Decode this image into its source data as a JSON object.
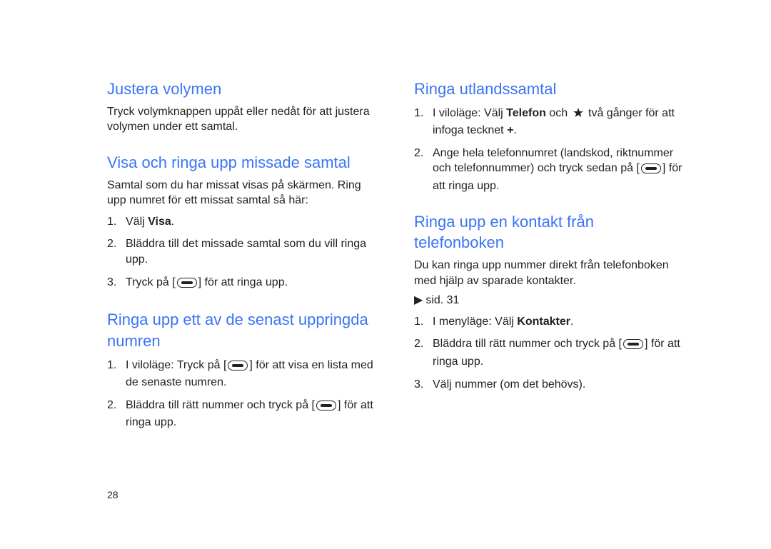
{
  "page_number": "28",
  "left": {
    "sec1": {
      "title": "Justera volymen",
      "p1": "Tryck volymknappen uppåt eller nedåt för att justera volymen under ett samtal."
    },
    "sec2": {
      "title": "Visa och ringa upp missade samtal",
      "p1": "Samtal som du har missat visas på skärmen. Ring upp numret för ett missat samtal så här:",
      "li1a": "Välj ",
      "li1b": "Visa",
      "li1c": ".",
      "li2": "Bläddra till det missade samtal som du vill ringa upp.",
      "li3a": "Tryck på [",
      "li3b": "] för att ringa upp."
    },
    "sec3": {
      "title": "Ringa upp ett av de senast uppringda numren",
      "li1a": "I viloläge: Tryck på [",
      "li1b": "] för att visa en lista med de senaste numren.",
      "li2a": "Bläddra till rätt nummer och tryck på [",
      "li2b": "] för att ringa upp."
    }
  },
  "right": {
    "sec1": {
      "title": "Ringa utlandssamtal",
      "li1a": "I viloläge: Välj ",
      "li1b": "Telefon",
      "li1c": " och ",
      "li1d": " två gånger för att infoga tecknet ",
      "li1e": "+",
      "li1f": ".",
      "li2a": "Ange hela telefonnumret (landskod, riktnummer och telefonnummer) och tryck sedan på [",
      "li2b": "] för att ringa upp."
    },
    "sec2": {
      "title": "Ringa upp en kontakt från telefonboken",
      "p1": "Du kan ringa upp nummer direkt från telefonboken med hjälp av sparade kontakter.",
      "ref": "sid. 31",
      "li1a": "I menyläge: Välj ",
      "li1b": "Kontakter",
      "li1c": ".",
      "li2a": "Bläddra till rätt nummer och tryck på [",
      "li2b": "] för att ringa upp.",
      "li3": "Välj nummer (om det behövs)."
    }
  }
}
